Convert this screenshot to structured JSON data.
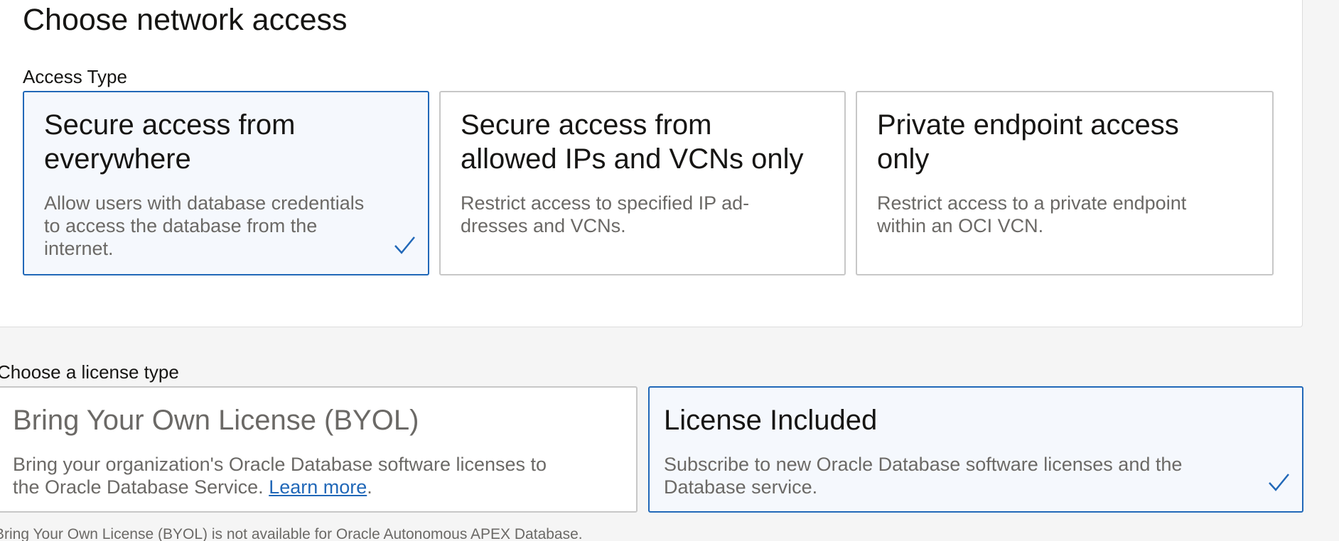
{
  "network": {
    "title": "Choose network access",
    "access_type_label": "Access Type",
    "options": [
      {
        "title": "Secure access from\neverywhere",
        "description": "Allow users with database credentials\nto access the database from the\ninternet.",
        "selected": true
      },
      {
        "title": "Secure access from\nallowed IPs and VCNs only",
        "description": "Restrict access to specified IP ad-\ndresses and VCNs.",
        "selected": false
      },
      {
        "title": "Private endpoint access\nonly",
        "description": "Restrict access to a private endpoint\nwithin an OCI VCN.",
        "selected": false
      }
    ]
  },
  "license": {
    "label": "Choose a license type",
    "options": [
      {
        "title": "Bring Your Own License (BYOL)",
        "description": "Bring your organization's Oracle Database software licenses to\nthe Oracle Database Service.",
        "link_text": "Learn more",
        "link_suffix": ".",
        "disabled": true,
        "selected": false
      },
      {
        "title": "License Included",
        "description": "Subscribe to new Oracle Database software licenses and the\nDatabase service.",
        "selected": true
      }
    ],
    "footnote": "Bring Your Own License (BYOL) is not available for Oracle Autonomous APEX Database."
  },
  "icons": {
    "check": "checkmark-icon"
  },
  "colors": {
    "accent": "#2168b8",
    "selected_background": "#f5f8fd",
    "muted_text": "#6b6966",
    "card_border": "#c7c7c7"
  }
}
